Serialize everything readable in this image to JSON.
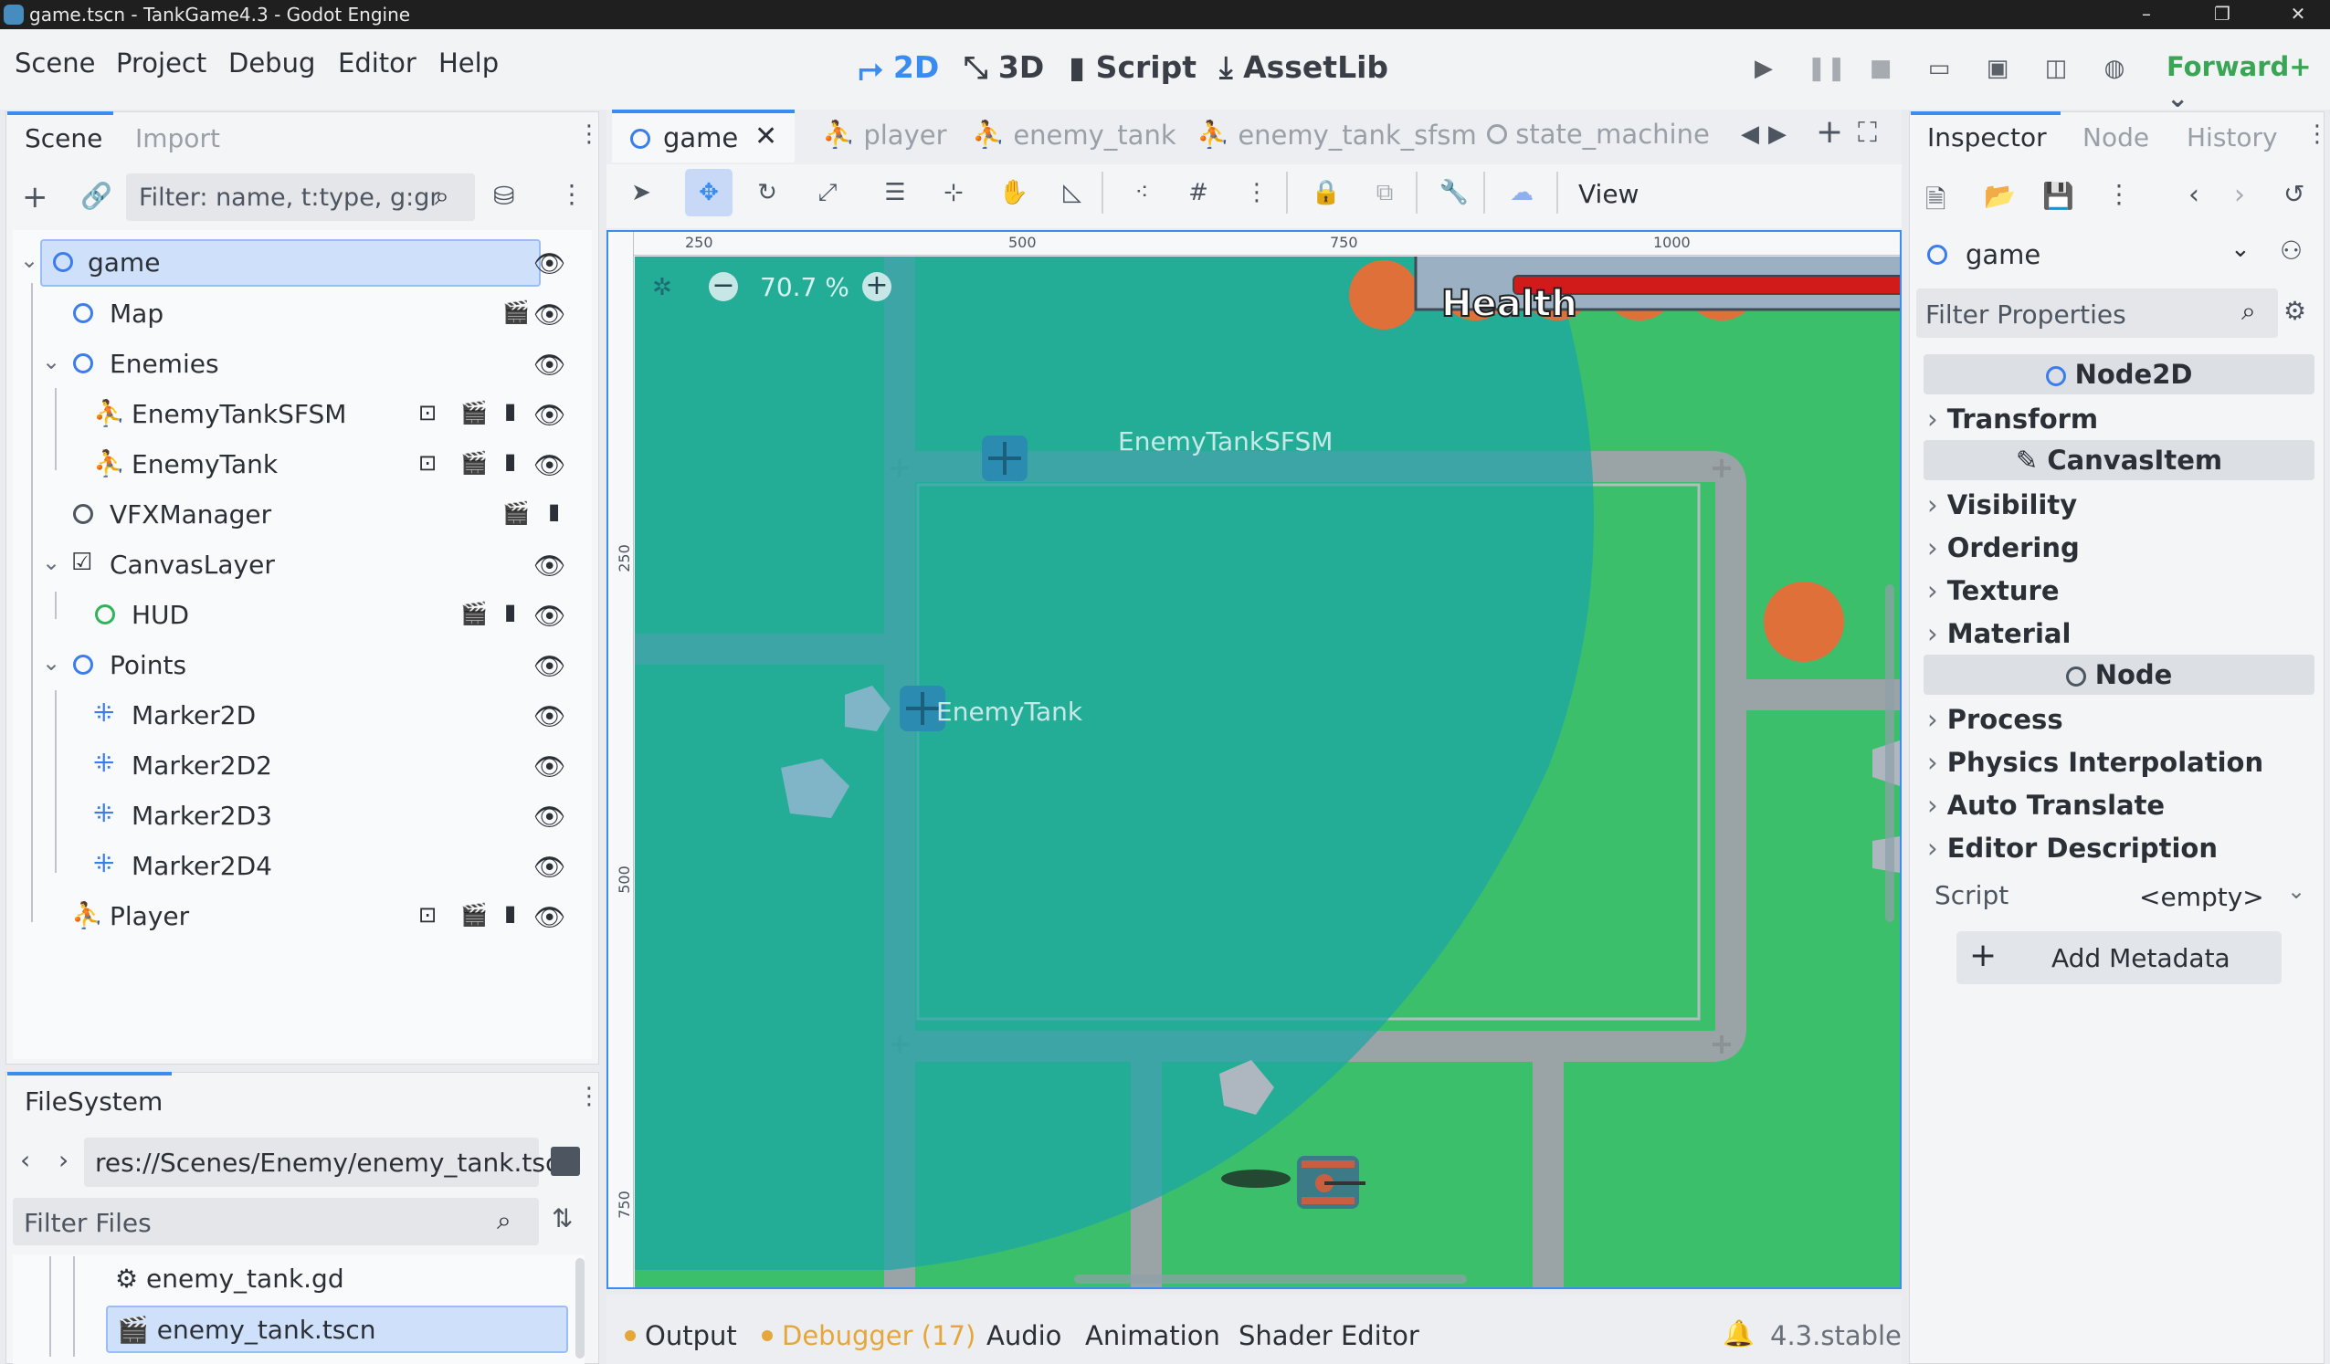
{
  "window": {
    "title": "game.tscn - TankGame4.3 - Godot Engine",
    "minimize": "–",
    "restore": "❐",
    "close": "✕"
  },
  "menu": [
    "Scene",
    "Project",
    "Debug",
    "Editor",
    "Help"
  ],
  "workspaces": {
    "two_d": "2D",
    "three_d": "3D",
    "script": "Script",
    "assetlib": "AssetLib"
  },
  "renderer": "Forward+",
  "scene_dock": {
    "tabs": [
      "Scene",
      "Import"
    ],
    "filter_placeholder": "Filter: name, t:type, g:gr",
    "nodes": [
      "game",
      "Map",
      "Enemies",
      "EnemyTankSFSM",
      "EnemyTank",
      "VFXManager",
      "CanvasLayer",
      "HUD",
      "Points",
      "Marker2D",
      "Marker2D2",
      "Marker2D3",
      "Marker2D4",
      "Player"
    ]
  },
  "filesystem": {
    "tab": "FileSystem",
    "path": "res://Scenes/Enemy/enemy_tank.tsc",
    "filter_placeholder": "Filter Files",
    "files": [
      "enemy_tank.gd",
      "enemy_tank.tscn"
    ]
  },
  "editor_tabs": [
    "game",
    "player",
    "enemy_tank",
    "enemy_tank_sfsm",
    "state_machine"
  ],
  "viewport": {
    "view_menu": "View",
    "zoom": "70.7 %",
    "ruler_top": [
      "250",
      "500",
      "750",
      "1000"
    ],
    "ruler_left": [
      "250",
      "500",
      "750"
    ],
    "labels": {
      "enemy_sfsm": "EnemyTankSFSM",
      "enemy_tank": "EnemyTank"
    },
    "health_label": "Health",
    "colors": {
      "grass": "#3cbf6b",
      "road": "#9aa3a6",
      "radius": "#1aa6a8",
      "bush": "#e0703a",
      "health": "#d11a1a"
    }
  },
  "bottom_bar": {
    "output": "Output",
    "debugger": "Debugger (17)",
    "audio": "Audio",
    "animation": "Animation",
    "shader": "Shader Editor",
    "version": "4.3.stable"
  },
  "inspector": {
    "tabs": [
      "Inspector",
      "Node",
      "History"
    ],
    "object": "game",
    "filter_placeholder": "Filter Properties",
    "sections": {
      "node2d": "Node2D",
      "transform": "Transform",
      "canvasitem": "CanvasItem",
      "visibility": "Visibility",
      "ordering": "Ordering",
      "texture": "Texture",
      "material": "Material",
      "node": "Node",
      "process": "Process",
      "physics": "Physics Interpolation",
      "autotranslate": "Auto Translate",
      "editordesc": "Editor Description"
    },
    "script_label": "Script",
    "script_value": "<empty>",
    "add_metadata": "Add Metadata"
  }
}
